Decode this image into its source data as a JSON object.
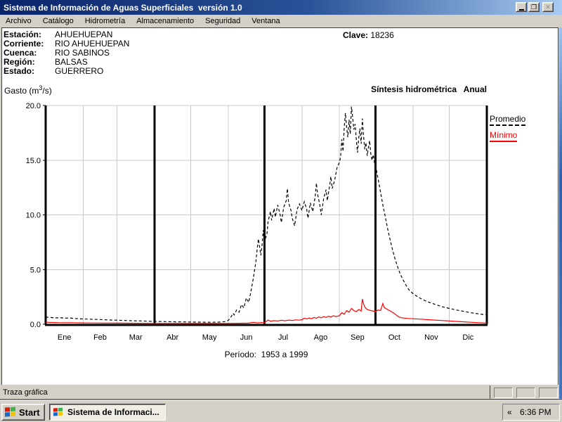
{
  "colors": {
    "chrome": "#d4d0c8",
    "title_gradient_start": "#0a246a",
    "title_gradient_end": "#a6caf0",
    "desktop_blue": "#4676b8"
  },
  "window": {
    "title": "Sistema de Información de Aguas Superficiales  versión 1.0",
    "minimize_glyph": "_",
    "restore_glyph": "❐",
    "close_glyph": "✕"
  },
  "menu": {
    "items": [
      "Archivo",
      "Catálogo",
      "Hidrometría",
      "Almacenamiento",
      "Seguridad",
      "Ventana"
    ]
  },
  "station": {
    "rows": [
      {
        "label": "Estación:",
        "value": "AHUEHUEPAN"
      },
      {
        "label": "Corriente:",
        "value": "RIO AHUEHUEPAN"
      },
      {
        "label": "Cuenca:",
        "value": "RIO SABINOS"
      },
      {
        "label": "Región:",
        "value": "BALSAS"
      },
      {
        "label": "Estado:",
        "value": "GUERRERO"
      }
    ],
    "clave_label": "Clave:",
    "clave_value": "18236"
  },
  "chart_data": {
    "type": "line",
    "title": "Síntesis hidrométrica   Anual",
    "ylabel": "Gasto (m3/s)",
    "ylabel_parts": {
      "prefix": "Gasto (m",
      "sup": "3",
      "suffix": "/s)"
    },
    "xlabel": "",
    "period_label": "Período:  1953 a 1999",
    "ylim": [
      0,
      20
    ],
    "y_ticks": [
      20,
      15,
      10,
      5,
      0
    ],
    "y_tick_labels": [
      "20.0",
      "15.0",
      "10.0",
      "5.0",
      "0.0"
    ],
    "categories": [
      "Ene",
      "Feb",
      "Mar",
      "Abr",
      "May",
      "Jun",
      "Jul",
      "Ago",
      "Sep",
      "Oct",
      "Nov",
      "Dic"
    ],
    "month_days": [
      31,
      28,
      31,
      30,
      31,
      30,
      31,
      31,
      30,
      31,
      30,
      31
    ],
    "quarter_boundary_days": [
      90,
      181,
      273
    ],
    "grid": true,
    "grid_color": "#c8c8c8",
    "legend_position": "right-outside",
    "x_unit": "day-of-year",
    "series": [
      {
        "name": "Promedio",
        "color": "#000000",
        "style": "dashed",
        "points": [
          [
            0,
            0.65
          ],
          [
            4,
            0.62
          ],
          [
            8,
            0.58
          ],
          [
            12,
            0.6
          ],
          [
            16,
            0.55
          ],
          [
            20,
            0.57
          ],
          [
            24,
            0.52
          ],
          [
            28,
            0.5
          ],
          [
            31,
            0.48
          ],
          [
            35,
            0.47
          ],
          [
            39,
            0.45
          ],
          [
            43,
            0.44
          ],
          [
            47,
            0.42
          ],
          [
            51,
            0.4
          ],
          [
            55,
            0.38
          ],
          [
            59,
            0.37
          ],
          [
            64,
            0.35
          ],
          [
            69,
            0.33
          ],
          [
            74,
            0.31
          ],
          [
            79,
            0.3
          ],
          [
            84,
            0.28
          ],
          [
            90,
            0.26
          ],
          [
            96,
            0.25
          ],
          [
            102,
            0.23
          ],
          [
            108,
            0.22
          ],
          [
            114,
            0.21
          ],
          [
            120,
            0.2
          ],
          [
            126,
            0.19
          ],
          [
            132,
            0.18
          ],
          [
            138,
            0.18
          ],
          [
            144,
            0.2
          ],
          [
            148,
            0.24
          ],
          [
            151,
            0.35
          ],
          [
            153,
            0.6
          ],
          [
            155,
            1.0
          ],
          [
            156,
            0.85
          ],
          [
            158,
            1.3
          ],
          [
            160,
            1.1
          ],
          [
            162,
            1.8
          ],
          [
            164,
            1.5
          ],
          [
            166,
            2.4
          ],
          [
            168,
            2.0
          ],
          [
            170,
            3.1
          ],
          [
            172,
            4.3
          ],
          [
            174,
            5.8
          ],
          [
            175,
            6.9
          ],
          [
            176,
            7.8
          ],
          [
            177,
            7.1
          ],
          [
            178,
            6.3
          ],
          [
            179,
            7.2
          ],
          [
            180,
            8.6
          ],
          [
            181,
            7.6
          ],
          [
            183,
            8.2
          ],
          [
            184,
            9.4
          ],
          [
            186,
            10.3
          ],
          [
            187,
            9.5
          ],
          [
            189,
            10.6
          ],
          [
            190,
            9.8
          ],
          [
            192,
            10.9
          ],
          [
            194,
            10.0
          ],
          [
            195,
            9.3
          ],
          [
            197,
            10.7
          ],
          [
            199,
            11.3
          ],
          [
            200,
            12.4
          ],
          [
            201,
            11.1
          ],
          [
            203,
            10.4
          ],
          [
            204,
            9.7
          ],
          [
            206,
            9.0
          ],
          [
            208,
            10.5
          ],
          [
            210,
            11.0
          ],
          [
            212,
            10.4
          ],
          [
            214,
            11.2
          ],
          [
            216,
            10.5
          ],
          [
            217,
            9.7
          ],
          [
            219,
            11.1
          ],
          [
            221,
            10.3
          ],
          [
            223,
            11.7
          ],
          [
            224,
            12.9
          ],
          [
            225,
            11.9
          ],
          [
            227,
            10.8
          ],
          [
            228,
            10.0
          ],
          [
            230,
            11.5
          ],
          [
            232,
            12.3
          ],
          [
            233,
            11.3
          ],
          [
            235,
            12.7
          ],
          [
            236,
            13.5
          ],
          [
            237,
            12.4
          ],
          [
            239,
            13.1
          ],
          [
            241,
            14.3
          ],
          [
            243,
            14.8
          ],
          [
            244,
            15.3
          ],
          [
            245,
            16.9
          ],
          [
            246,
            15.8
          ],
          [
            247,
            18.0
          ],
          [
            248,
            19.3
          ],
          [
            249,
            18.0
          ],
          [
            250,
            17.1
          ],
          [
            251,
            18.7
          ],
          [
            252,
            17.4
          ],
          [
            253,
            19.9
          ],
          [
            254,
            18.9
          ],
          [
            255,
            17.8
          ],
          [
            256,
            18.3
          ],
          [
            257,
            16.9
          ],
          [
            258,
            15.7
          ],
          [
            259,
            17.0
          ],
          [
            260,
            17.9
          ],
          [
            261,
            16.5
          ],
          [
            262,
            18.8
          ],
          [
            263,
            17.2
          ],
          [
            264,
            16.0
          ],
          [
            265,
            16.6
          ],
          [
            266,
            15.4
          ],
          [
            267,
            16.1
          ],
          [
            268,
            16.8
          ],
          [
            269,
            15.6
          ],
          [
            270,
            15.0
          ],
          [
            271,
            15.5
          ],
          [
            272,
            14.8
          ],
          [
            273,
            14.5
          ],
          [
            275,
            13.3
          ],
          [
            277,
            12.1
          ],
          [
            279,
            10.9
          ],
          [
            281,
            9.8
          ],
          [
            283,
            8.7
          ],
          [
            285,
            7.7
          ],
          [
            287,
            6.8
          ],
          [
            289,
            6.0
          ],
          [
            291,
            5.3
          ],
          [
            293,
            4.7
          ],
          [
            295,
            4.2
          ],
          [
            297,
            3.8
          ],
          [
            299,
            3.4
          ],
          [
            301,
            3.1
          ],
          [
            304,
            2.8
          ],
          [
            308,
            2.5
          ],
          [
            312,
            2.25
          ],
          [
            316,
            2.05
          ],
          [
            320,
            1.9
          ],
          [
            324,
            1.75
          ],
          [
            328,
            1.6
          ],
          [
            334,
            1.45
          ],
          [
            340,
            1.3
          ],
          [
            346,
            1.18
          ],
          [
            352,
            1.05
          ],
          [
            358,
            0.95
          ],
          [
            365,
            0.85
          ]
        ]
      },
      {
        "name": "Mínimo",
        "color": "#ff0000",
        "style": "solid",
        "points": [
          [
            0,
            0.18
          ],
          [
            10,
            0.15
          ],
          [
            20,
            0.14
          ],
          [
            31,
            0.12
          ],
          [
            45,
            0.11
          ],
          [
            59,
            0.1
          ],
          [
            75,
            0.09
          ],
          [
            90,
            0.08
          ],
          [
            105,
            0.08
          ],
          [
            120,
            0.07
          ],
          [
            135,
            0.07
          ],
          [
            150,
            0.08
          ],
          [
            160,
            0.09
          ],
          [
            168,
            0.1
          ],
          [
            172,
            0.18
          ],
          [
            175,
            0.12
          ],
          [
            178,
            0.15
          ],
          [
            181,
            0.15
          ],
          [
            184,
            0.38
          ],
          [
            186,
            0.28
          ],
          [
            189,
            0.33
          ],
          [
            192,
            0.3
          ],
          [
            195,
            0.36
          ],
          [
            198,
            0.32
          ],
          [
            201,
            0.38
          ],
          [
            204,
            0.35
          ],
          [
            207,
            0.4
          ],
          [
            210,
            0.37
          ],
          [
            212,
            0.42
          ],
          [
            214,
            0.55
          ],
          [
            216,
            0.48
          ],
          [
            218,
            0.58
          ],
          [
            220,
            0.5
          ],
          [
            222,
            0.62
          ],
          [
            224,
            0.55
          ],
          [
            226,
            0.66
          ],
          [
            228,
            0.58
          ],
          [
            230,
            0.7
          ],
          [
            232,
            0.62
          ],
          [
            234,
            0.74
          ],
          [
            236,
            0.66
          ],
          [
            238,
            0.78
          ],
          [
            240,
            0.7
          ],
          [
            243,
            0.78
          ],
          [
            245,
            1.05
          ],
          [
            247,
            0.92
          ],
          [
            249,
            1.25
          ],
          [
            251,
            1.1
          ],
          [
            253,
            1.45
          ],
          [
            255,
            1.25
          ],
          [
            257,
            1.15
          ],
          [
            259,
            1.35
          ],
          [
            261,
            1.2
          ],
          [
            262,
            2.3
          ],
          [
            263,
            1.85
          ],
          [
            264,
            1.6
          ],
          [
            265,
            1.45
          ],
          [
            266,
            1.35
          ],
          [
            268,
            1.28
          ],
          [
            270,
            1.22
          ],
          [
            273,
            1.18
          ],
          [
            275,
            1.3
          ],
          [
            277,
            1.25
          ],
          [
            279,
            1.9
          ],
          [
            280,
            1.55
          ],
          [
            282,
            1.4
          ],
          [
            284,
            1.28
          ],
          [
            286,
            1.15
          ],
          [
            288,
            1.02
          ],
          [
            290,
            0.85
          ],
          [
            292,
            0.68
          ],
          [
            294,
            0.6
          ],
          [
            297,
            0.56
          ],
          [
            300,
            0.53
          ],
          [
            304,
            0.5
          ],
          [
            310,
            0.46
          ],
          [
            316,
            0.42
          ],
          [
            322,
            0.38
          ],
          [
            328,
            0.34
          ],
          [
            334,
            0.3
          ],
          [
            340,
            0.26
          ],
          [
            346,
            0.22
          ],
          [
            352,
            0.18
          ],
          [
            358,
            0.14
          ],
          [
            365,
            0.1
          ]
        ]
      }
    ]
  },
  "status_bar": {
    "text": "Traza gráfica"
  },
  "taskbar": {
    "start_label": "Start",
    "task_label": "Sistema de Informaci...",
    "tray_chevron": "«",
    "clock": "6:36 PM"
  }
}
